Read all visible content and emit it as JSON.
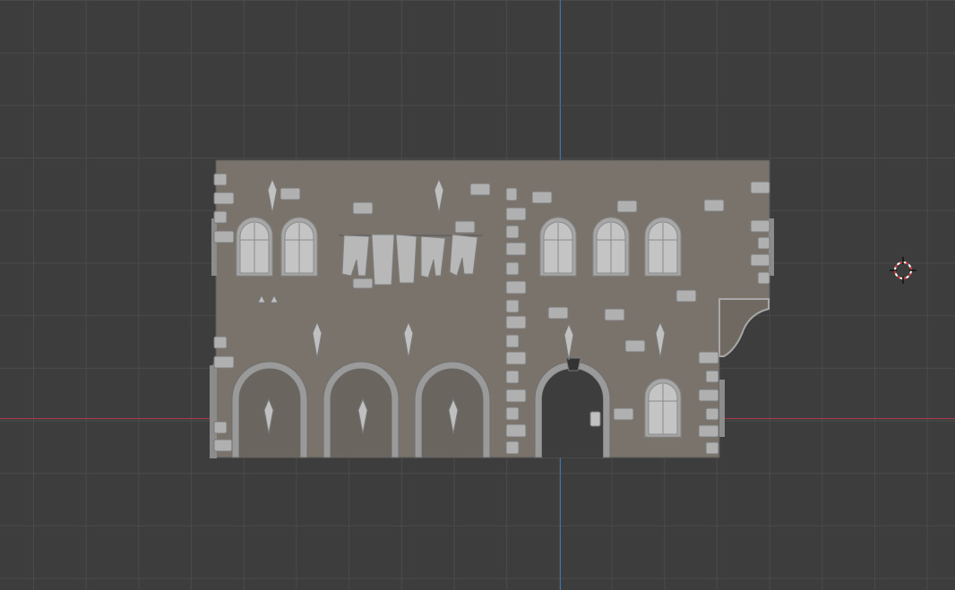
{
  "viewport": {
    "background_color": "#3d3d3d",
    "grid_color": "#4a4a4a",
    "x_axis_color": "#b03a48",
    "y_axis_color": "#3d72b4"
  },
  "model": {
    "wall_color": "#7a736c",
    "trim_color": "#a7a7a7",
    "window_color": "#c4c4c4",
    "edge_color": "#5a5a5a"
  },
  "icons": {
    "cursor": "3d-cursor-icon"
  }
}
